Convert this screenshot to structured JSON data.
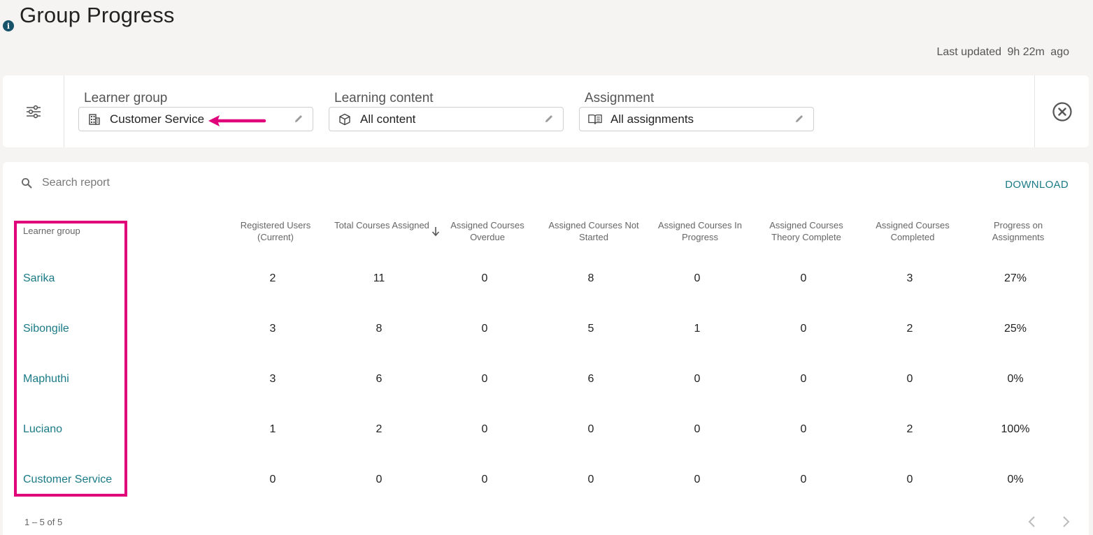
{
  "page": {
    "title": "Group Progress",
    "last_updated_label": "Last updated",
    "last_updated_value": "9h 22m",
    "last_updated_suffix": "ago"
  },
  "filters": {
    "learner_group": {
      "label": "Learner group",
      "value": "Customer Service"
    },
    "learning_content": {
      "label": "Learning content",
      "value": "All content"
    },
    "assignment": {
      "label": "Assignment",
      "value": "All assignments"
    }
  },
  "report": {
    "search_placeholder": "Search report",
    "download_label": "DOWNLOAD",
    "columns": {
      "group": "Learner group",
      "registered": "Registered Users (Current)",
      "total": "Total Courses Assigned",
      "overdue": "Assigned Courses Overdue",
      "not_started": "Assigned Courses Not Started",
      "in_progress": "Assigned Courses In Progress",
      "theory": "Assigned Courses Theory Complete",
      "completed": "Assigned Courses Completed",
      "progress": "Progress on Assignments"
    },
    "rows": [
      {
        "name": "Sarika",
        "registered": "2",
        "total": "11",
        "overdue": "0",
        "not_started": "8",
        "in_progress": "0",
        "theory": "0",
        "completed": "3",
        "progress": "27%"
      },
      {
        "name": "Sibongile",
        "registered": "3",
        "total": "8",
        "overdue": "0",
        "not_started": "5",
        "in_progress": "1",
        "theory": "0",
        "completed": "2",
        "progress": "25%"
      },
      {
        "name": "Maphuthi",
        "registered": "3",
        "total": "6",
        "overdue": "0",
        "not_started": "6",
        "in_progress": "0",
        "theory": "0",
        "completed": "0",
        "progress": "0%"
      },
      {
        "name": "Luciano",
        "registered": "1",
        "total": "2",
        "overdue": "0",
        "not_started": "0",
        "in_progress": "0",
        "theory": "0",
        "completed": "2",
        "progress": "100%"
      },
      {
        "name": "Customer Service",
        "registered": "0",
        "total": "0",
        "overdue": "0",
        "not_started": "0",
        "in_progress": "0",
        "theory": "0",
        "completed": "0",
        "progress": "0%"
      }
    ],
    "pagination": "1 – 5 of 5"
  },
  "colors": {
    "accent_teal": "#1a7a86",
    "annotation_magenta": "#e0007a",
    "info_icon": "#17526b"
  },
  "icons": {
    "info": "info-icon",
    "filter": "sliders-icon",
    "clear": "close-circle-icon",
    "learner_group": "building-icon",
    "learning_content": "cube-icon",
    "assignment": "book-icon",
    "edit": "pencil-icon",
    "search": "search-icon",
    "sort": "arrow-down-icon",
    "prev": "chevron-left-icon",
    "next": "chevron-right-icon"
  }
}
